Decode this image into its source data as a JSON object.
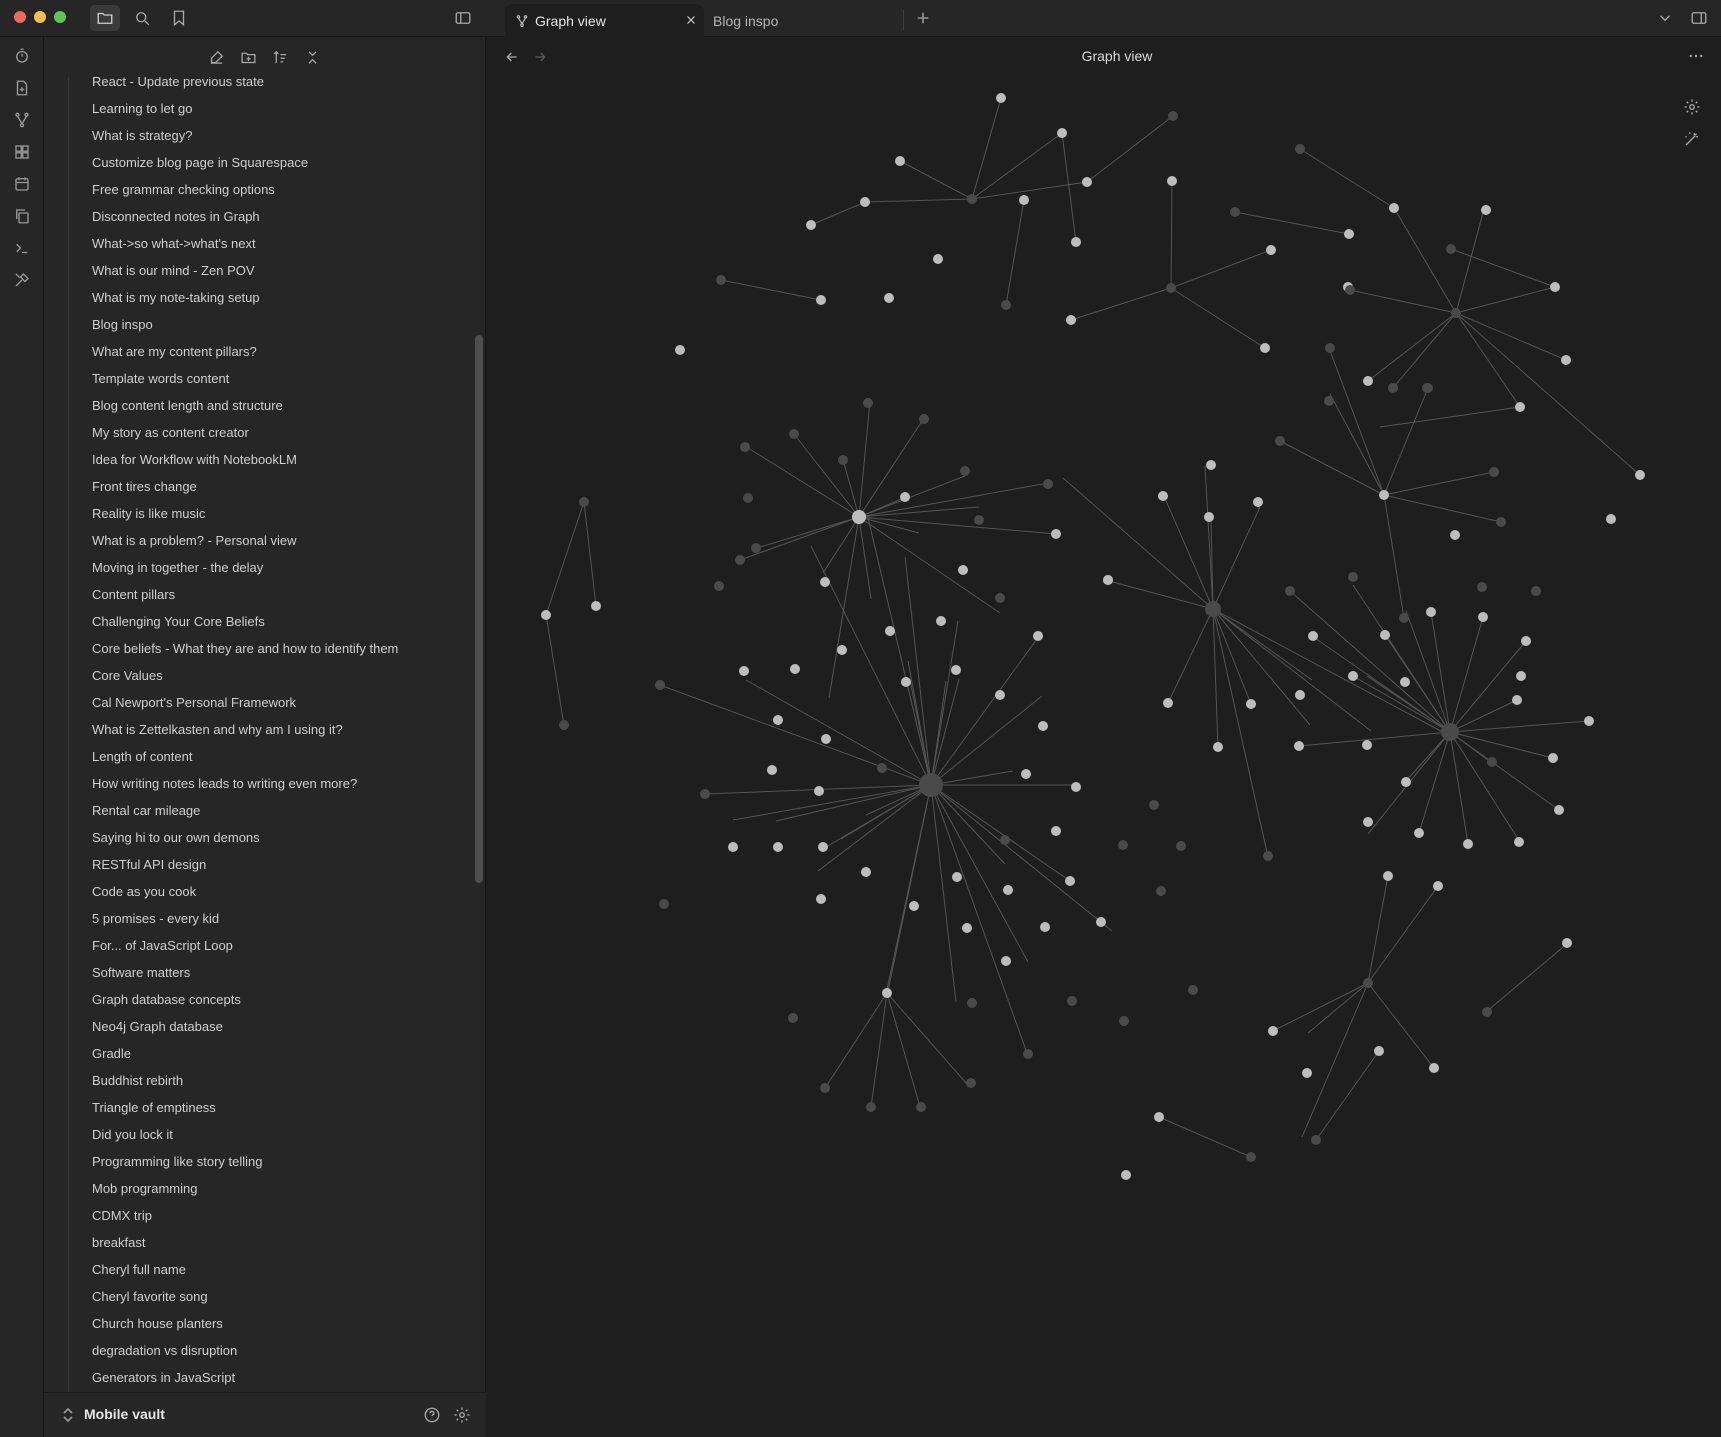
{
  "tabs": [
    {
      "label": "Graph view",
      "icon": "graph-icon",
      "active": true
    },
    {
      "label": "Blog inspo",
      "icon": null,
      "active": false
    }
  ],
  "view": {
    "title": "Graph view"
  },
  "vault": {
    "name": "Mobile vault"
  },
  "files": [
    "React - Update previous state",
    "Learning to let go",
    "What is strategy?",
    "Customize blog page in Squarespace",
    "Free grammar checking options",
    "Disconnected notes in Graph",
    "What->so what->what's next",
    "What is our mind - Zen POV",
    "What is my note-taking setup",
    "Blog inspo",
    "What are my content pillars?",
    "Template words content",
    "Blog content length and structure",
    "My story as content creator",
    "Idea for Workflow with NotebookLM",
    "Front tires change",
    "Reality is like music",
    "What is a problem? - Personal view",
    "Moving in together - the delay",
    "Content pillars",
    "Challenging Your Core Beliefs",
    "Core beliefs - What they are and how to identify them",
    "Core Values",
    "Cal Newport's Personal Framework",
    "What is Zettelkasten and why am I using it?",
    "Length of content",
    "How writing notes leads to writing even more?",
    "Rental car mileage",
    "Saying hi to our own demons",
    "RESTful API design",
    "Code as you cook",
    "5 promises - every kid",
    "For... of JavaScript Loop",
    "Software matters",
    "Graph database concepts",
    "Neo4j Graph database",
    "Gradle",
    "Buddhist rebirth",
    "Triangle of emptiness",
    "Did you lock it",
    "Programming like story telling",
    "Mob programming",
    "CDMX trip",
    "breakfast",
    "Cheryl full name",
    "Cheryl favorite song",
    "Church house planters",
    "degradation vs disruption",
    "Generators in JavaScript"
  ],
  "colors": {
    "accent": "#cfcfcf",
    "node": "#bdbdbd",
    "node_dim": "#4a4a4a",
    "edge": "#555555",
    "background": "#1e1e1e"
  },
  "icons": {
    "titlebar": [
      "folder-icon",
      "search-icon",
      "bookmark-icon",
      "sidebar-toggle-icon"
    ],
    "ribbon": [
      "clock-icon",
      "file-import-icon",
      "graph-icon",
      "canvas-icon",
      "calendar-icon",
      "copy-icon",
      "terminal-icon",
      "tools-icon"
    ],
    "sidebar_toolbar": [
      "new-note-icon",
      "new-folder-icon",
      "sort-icon",
      "collapse-icon"
    ]
  }
}
